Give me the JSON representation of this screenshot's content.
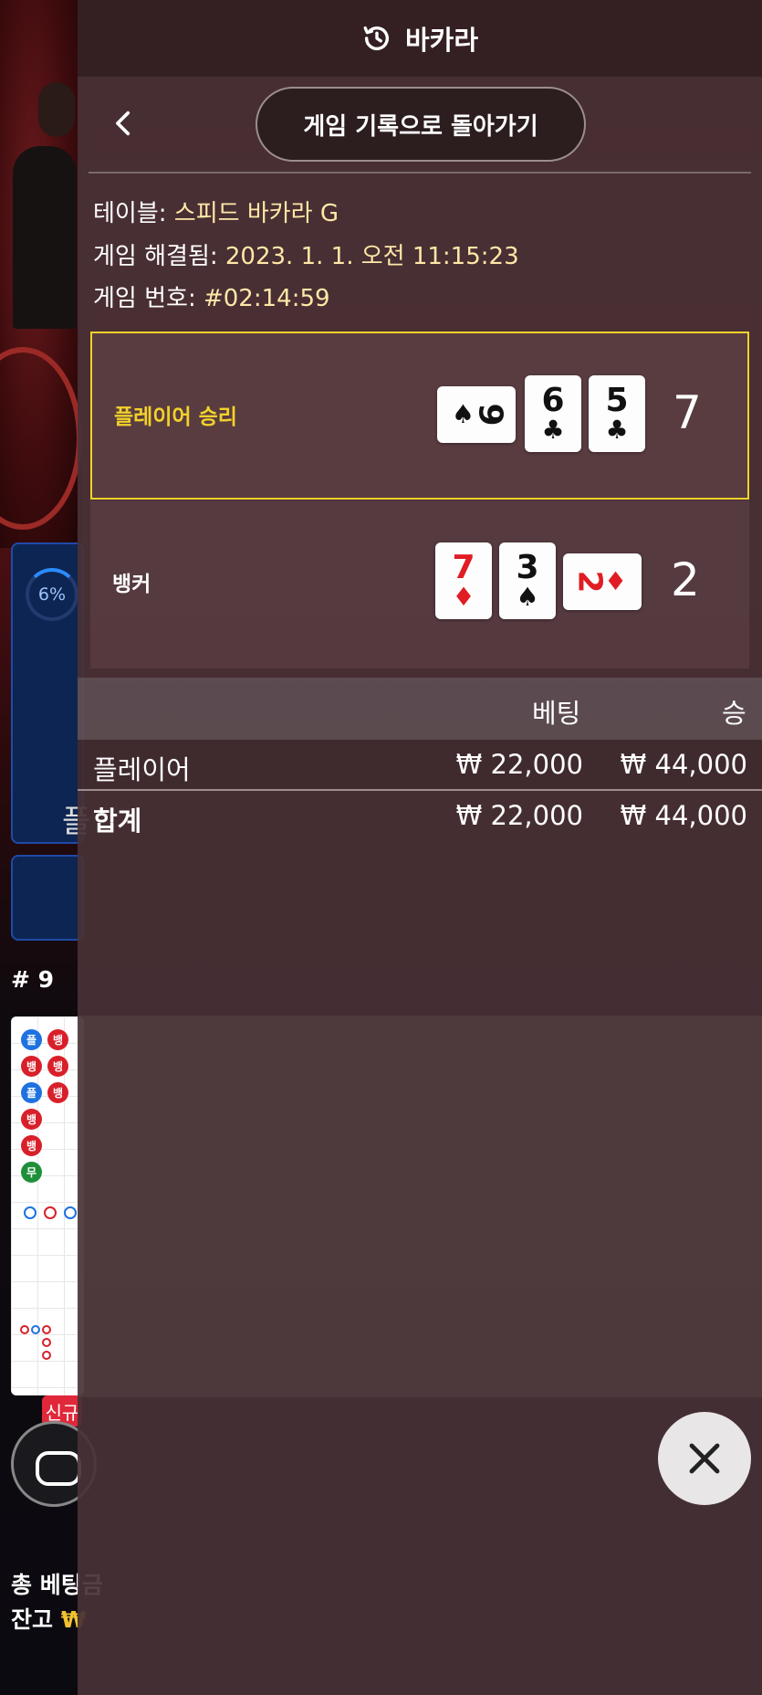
{
  "header": {
    "title": "바카라",
    "icon": "history-icon"
  },
  "nav": {
    "back_label": "게임 기록으로 돌아가기",
    "back_icon": "chevron-left-icon"
  },
  "meta": {
    "table_label": "테이블:",
    "table_value": "스피드 바카라 G",
    "resolved_label": "게임 해결됨:",
    "resolved_value": "2023. 1. 1. 오전 11:15:23",
    "game_no_label": "게임 번호:",
    "game_no_value": "#02:14:59"
  },
  "results": {
    "player": {
      "label": "플레이어 승리",
      "score": "7",
      "cards": [
        {
          "rank": "9",
          "suit": "♠",
          "color": "black",
          "orientation": "horizontal"
        },
        {
          "rank": "6",
          "suit": "♣",
          "color": "black",
          "orientation": "vertical"
        },
        {
          "rank": "5",
          "suit": "♣",
          "color": "black",
          "orientation": "vertical"
        }
      ]
    },
    "banker": {
      "label": "뱅커",
      "score": "2",
      "cards": [
        {
          "rank": "7",
          "suit": "♦",
          "color": "red",
          "orientation": "vertical"
        },
        {
          "rank": "3",
          "suit": "♠",
          "color": "black",
          "orientation": "vertical"
        },
        {
          "rank": "2",
          "suit": "♦",
          "color": "red",
          "orientation": "horizontal"
        }
      ]
    },
    "winner_color": "#f2d22a"
  },
  "bets": {
    "col_bet": "베팅",
    "col_win": "승",
    "rows": [
      {
        "name": "플레이어",
        "bet": "₩ 22,000",
        "win": "₩ 44,000"
      }
    ],
    "total": {
      "name": "합계",
      "bet": "₩ 22,000",
      "win": "₩ 44,000"
    }
  },
  "close": {
    "icon": "close-icon"
  },
  "background": {
    "progress_text": "6%",
    "progress": 0.06,
    "panel_label": "플",
    "round_label": "# 9",
    "road_labels": [
      "플",
      "뱅",
      "뱅",
      "뱅",
      "플",
      "뱅",
      "뱅",
      "뱅",
      "무"
    ],
    "new_badge": "신규",
    "total_bet_label": "총 베팅금",
    "balance_label": "잔고",
    "balance_value": "₩"
  }
}
